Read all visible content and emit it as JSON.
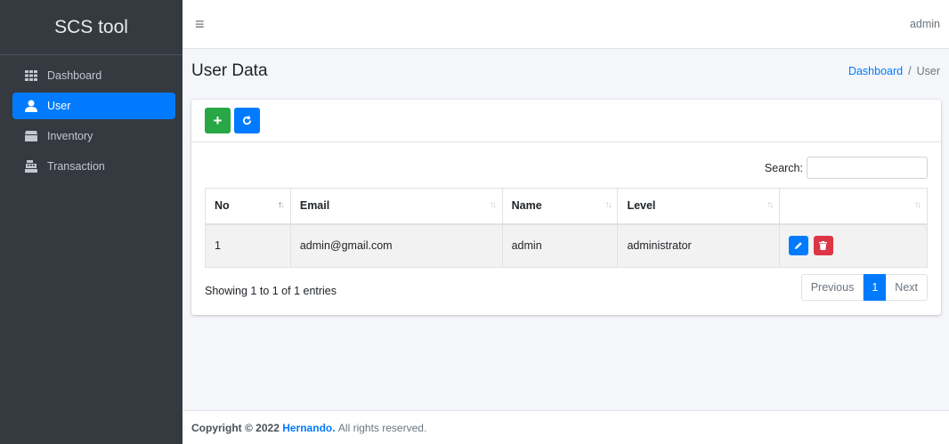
{
  "sidebar": {
    "brand": "SCS tool",
    "items": [
      {
        "label": "Dashboard",
        "icon": "grid-icon"
      },
      {
        "label": "User",
        "icon": "user-icon"
      },
      {
        "label": "Inventory",
        "icon": "box-icon"
      },
      {
        "label": "Transaction",
        "icon": "cash-register-icon"
      }
    ]
  },
  "topbar": {
    "user": "admin"
  },
  "header": {
    "title": "User Data",
    "breadcrumb": [
      "Dashboard",
      "User"
    ]
  },
  "table": {
    "search_label": "Search:",
    "search_value": "",
    "columns": [
      "No",
      "Email",
      "Name",
      "Level",
      ""
    ],
    "rows": [
      {
        "no": "1",
        "email": "admin@gmail.com",
        "name": "admin",
        "level": "administrator"
      }
    ],
    "info": "Showing 1 to 1 of 1 entries"
  },
  "pagination": {
    "previous": "Previous",
    "current": "1",
    "next": "Next"
  },
  "footer": {
    "prefix": "Copyright © 2022",
    "author": "Hernando.",
    "suffix": "All rights reserved."
  },
  "colors": {
    "sidebar_bg": "#343a40",
    "primary": "#007bff",
    "success": "#28a745",
    "danger": "#dc3545",
    "content_bg": "#f4f6f9"
  }
}
